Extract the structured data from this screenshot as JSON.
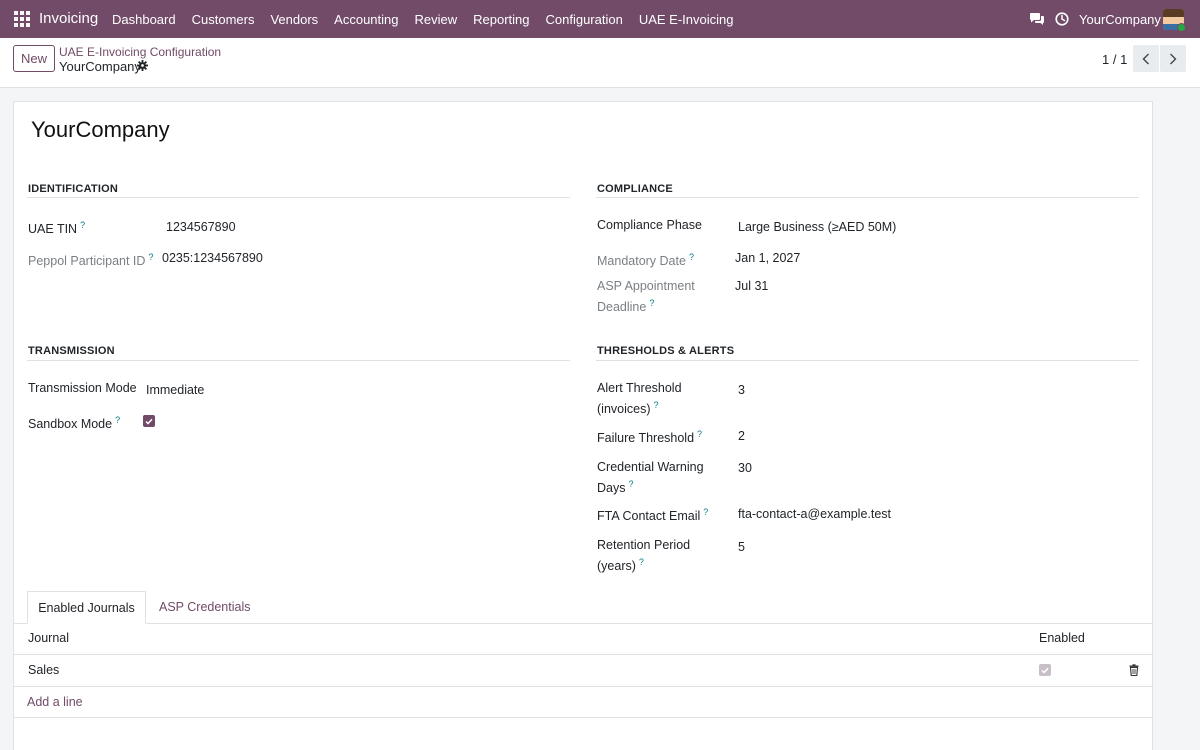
{
  "navbar": {
    "app_name": "Invoicing",
    "menu": [
      "Dashboard",
      "Customers",
      "Vendors",
      "Accounting",
      "Review",
      "Reporting",
      "Configuration",
      "UAE E-Invoicing"
    ],
    "company": "YourCompany",
    "icons": [
      "apps-grid-icon",
      "chat-icon",
      "clock-icon"
    ],
    "accent_color": "#714b67"
  },
  "control": {
    "new_label": "New",
    "breadcrumb_parent": "UAE E-Invoicing Configuration",
    "breadcrumb_current": "YourCompany",
    "pager": "1 / 1"
  },
  "record": {
    "title": "YourCompany"
  },
  "identification": {
    "title": "IDENTIFICATION",
    "tin_label": "UAE TIN",
    "tin_value": "1234567890",
    "peppol_label": "Peppol Participant ID",
    "peppol_value": "0235:1234567890"
  },
  "compliance": {
    "title": "COMPLIANCE",
    "phase_label": "Compliance Phase",
    "phase_value": "Large Business (≥AED 50M)",
    "mandatory_label": "Mandatory Date",
    "mandatory_value": "Jan 1, 2027",
    "asp_label_1": "ASP Appointment",
    "asp_label_2": "Deadline",
    "asp_value": "Jul 31"
  },
  "transmission": {
    "title": "TRANSMISSION",
    "mode_label": "Transmission Mode",
    "mode_value": "Immediate",
    "sandbox_label": "Sandbox Mode",
    "sandbox_checked": true
  },
  "thresholds": {
    "title": "THRESHOLDS & ALERTS",
    "alert_label_1": "Alert Threshold",
    "alert_label_2": "(invoices)",
    "alert_value": "3",
    "failure_label": "Failure Threshold",
    "failure_value": "2",
    "credential_label_1": "Credential Warning",
    "credential_label_2": "Days",
    "credential_value": "30",
    "email_label": "FTA Contact Email",
    "email_value": "fta-contact-a@example.test",
    "retention_label_1": "Retention Period",
    "retention_label_2": "(years)",
    "retention_value": "5"
  },
  "notebook": {
    "tabs": [
      "Enabled Journals",
      "ASP Credentials"
    ],
    "columns": [
      "Journal",
      "Enabled"
    ],
    "rows": [
      {
        "journal": "Sales",
        "enabled": true
      }
    ],
    "add_line": "Add a line"
  }
}
